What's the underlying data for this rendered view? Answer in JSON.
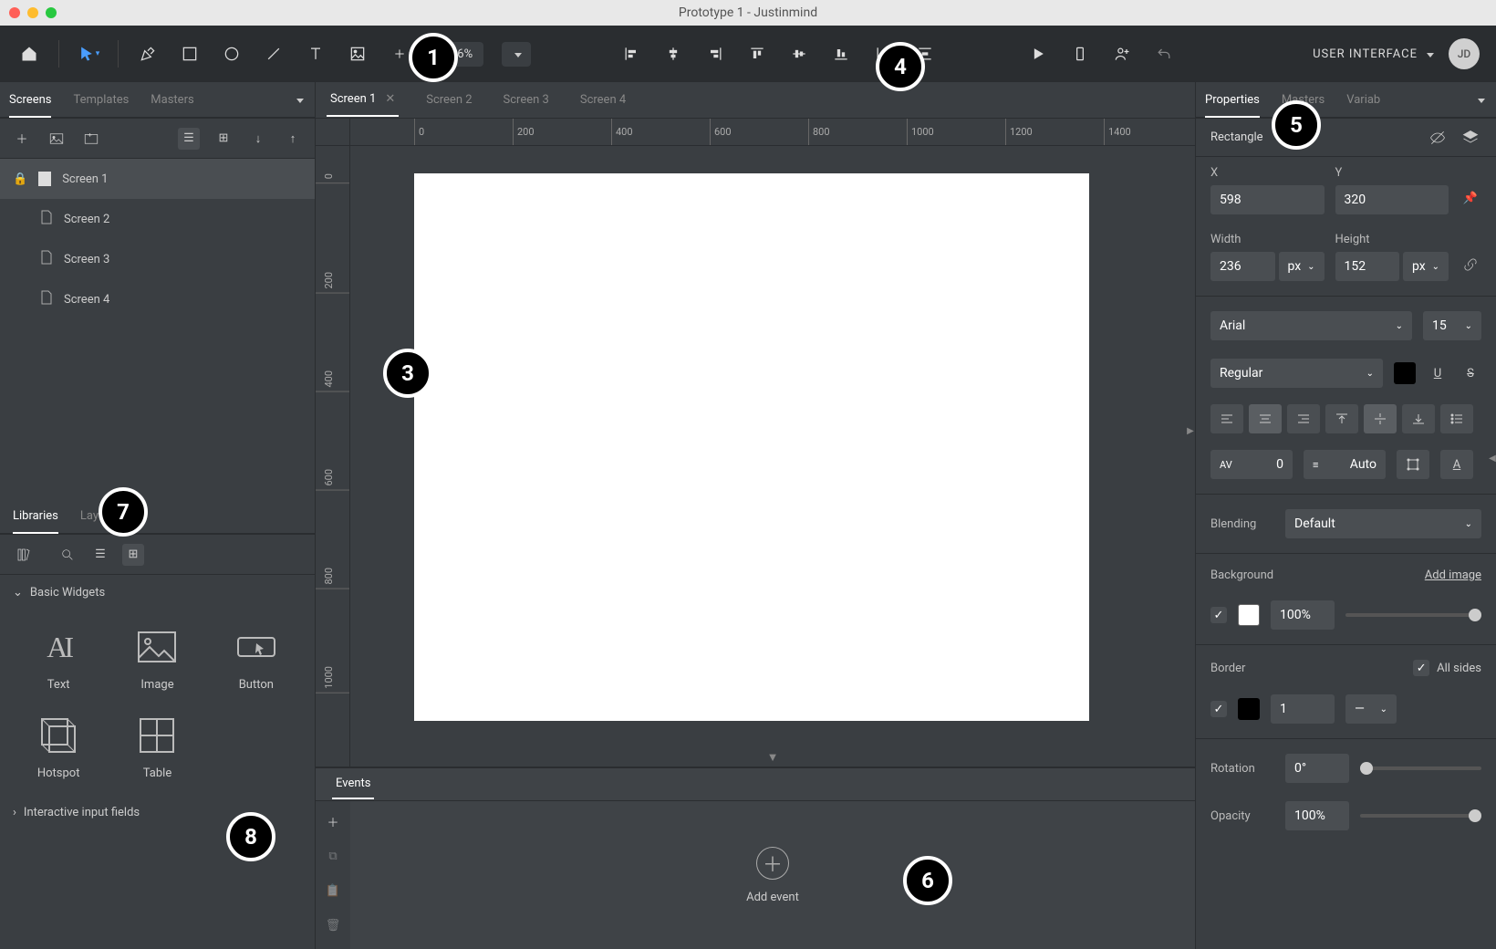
{
  "window": {
    "title": "Prototype 1 - Justinmind"
  },
  "toolbar": {
    "zoom": "36%",
    "dropdown": "USER INTERFACE",
    "avatar": "JD"
  },
  "left": {
    "tabs": [
      "Screens",
      "Templates",
      "Masters"
    ],
    "screens": [
      "Screen 1",
      "Screen 2",
      "Screen 3",
      "Screen 4"
    ],
    "lib_tabs": [
      "Libraries",
      "Layers"
    ],
    "section_basic": "Basic Widgets",
    "section_inputs": "Interactive input fields",
    "widgets": {
      "text": "Text",
      "image": "Image",
      "button": "Button",
      "hotspot": "Hotspot",
      "table": "Table"
    }
  },
  "center": {
    "tabs": [
      "Screen 1",
      "Screen 2",
      "Screen 3",
      "Screen 4"
    ],
    "ruler_h": [
      "0",
      "200",
      "400",
      "600",
      "800",
      "1000",
      "1200",
      "1400"
    ],
    "ruler_v": [
      "0",
      "200",
      "400",
      "600",
      "800",
      "1000"
    ],
    "events_tab": "Events",
    "add_event": "Add event"
  },
  "right": {
    "tabs": [
      "Properties",
      "Masters",
      "Variab"
    ],
    "element": "Rectangle",
    "x_label": "X",
    "y_label": "Y",
    "x": "598",
    "y": "320",
    "w_label": "Width",
    "h_label": "Height",
    "w": "236",
    "h": "152",
    "unit": "px",
    "font": "Arial",
    "fontsize": "15",
    "weight": "Regular",
    "spacing": "0",
    "lineheight": "Auto",
    "blend_label": "Blending",
    "blend": "Default",
    "bg_label": "Background",
    "add_image": "Add image",
    "bg_opacity": "100%",
    "border_label": "Border",
    "all_sides": "All sides",
    "border_w": "1",
    "rotation_label": "Rotation",
    "rotation": "0°",
    "opacity_label": "Opacity",
    "opacity": "100%"
  },
  "callouts": {
    "1": "1",
    "3": "3",
    "4": "4",
    "5": "5",
    "6": "6",
    "7": "7",
    "8": "8"
  }
}
